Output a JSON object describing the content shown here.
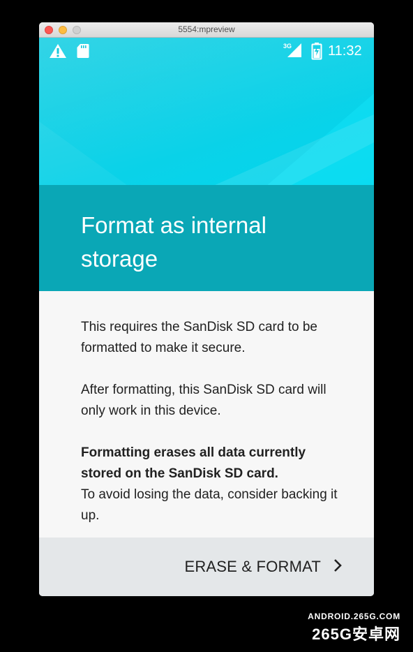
{
  "window": {
    "title": "5554:mpreview"
  },
  "status_bar": {
    "left_icons": [
      "warning-icon",
      "sd-card-icon"
    ],
    "network": "3G",
    "right_icons": [
      "signal-icon",
      "battery-charging-icon"
    ],
    "time": "11:32"
  },
  "dialog": {
    "title": "Format as internal storage",
    "paragraphs": [
      "This requires the SanDisk SD card to be formatted to make it secure.",
      "After formatting, this SanDisk SD card will only work in this device.",
      "Formatting erases all data currently stored on the SanDisk SD card.",
      "To avoid losing the data, consider backing it up."
    ],
    "action_label": "ERASE & FORMAT"
  },
  "watermark": {
    "url": "ANDROID.265G.COM",
    "brand": "265G安卓网"
  },
  "colors": {
    "hero": "#0bd2e8",
    "header_band": "#0aa7b6",
    "body": "#f7f7f7",
    "footer": "#e4e7e9"
  }
}
